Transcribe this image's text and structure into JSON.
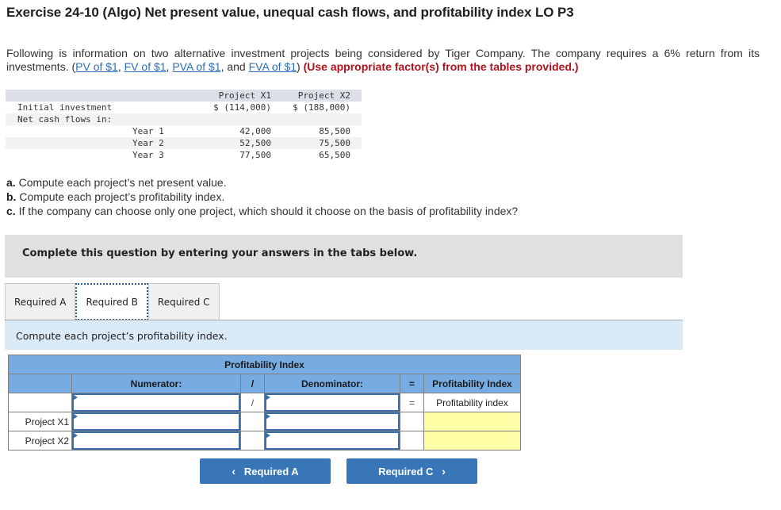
{
  "title": "Exercise 24-10 (Algo) Net present value, unequal cash flows, and profitability index LO P3",
  "intro": {
    "text": "Following is information on two alternative investment projects being considered by Tiger Company. The company requires a 6% return from its investments. (",
    "links": [
      "PV of $1",
      "FV of $1",
      "PVA of $1",
      "FVA of $1"
    ],
    "sep1": ", ",
    "sep2": ", ",
    "sep3": ", and ",
    "close": ") ",
    "instruction": "(Use appropriate factor(s) from the tables provided.)"
  },
  "info_table": {
    "headers": [
      "",
      "",
      "Project X1",
      "Project X2"
    ],
    "rows": [
      {
        "label": "Initial investment",
        "sub": "",
        "x1": "$ (114,000)",
        "x2": "$ (188,000)"
      },
      {
        "label": "Net cash flows in:",
        "sub": "",
        "x1": "",
        "x2": ""
      },
      {
        "label": "",
        "sub": "Year 1",
        "x1": "42,000",
        "x2": "85,500"
      },
      {
        "label": "",
        "sub": "Year 2",
        "x1": "52,500",
        "x2": "75,500"
      },
      {
        "label": "",
        "sub": "Year 3",
        "x1": "77,500",
        "x2": "65,500"
      }
    ]
  },
  "requirements": [
    {
      "letter": "a.",
      "text": " Compute each project’s net present value."
    },
    {
      "letter": "b.",
      "text": " Compute each project’s profitability index."
    },
    {
      "letter": "c.",
      "text": " If the company can choose only one project, which should it choose on the basis of profitability index?"
    }
  ],
  "banner": "Complete this question by entering your answers in the tabs below.",
  "tabs": [
    {
      "label": "Required A",
      "active": false
    },
    {
      "label": "Required B",
      "active": true
    },
    {
      "label": "Required C",
      "active": false
    }
  ],
  "instruction": "Compute each project’s profitability index.",
  "pi_table": {
    "title": "Profitability Index",
    "headers": {
      "numerator": "Numerator:",
      "divide": "/",
      "denominator": "Denominator:",
      "equals": "=",
      "result": "Profitability Index"
    },
    "formula_row": {
      "divide": "/",
      "equals": "=",
      "result": "Profitability index"
    },
    "rows": [
      {
        "label": "Project X1",
        "numerator": "",
        "denominator": "",
        "result": ""
      },
      {
        "label": "Project X2",
        "numerator": "",
        "denominator": "",
        "result": ""
      }
    ]
  },
  "nav": {
    "prev": {
      "label": "Required A",
      "icon": "‹"
    },
    "next": {
      "label": "Required C",
      "icon": "›"
    }
  }
}
